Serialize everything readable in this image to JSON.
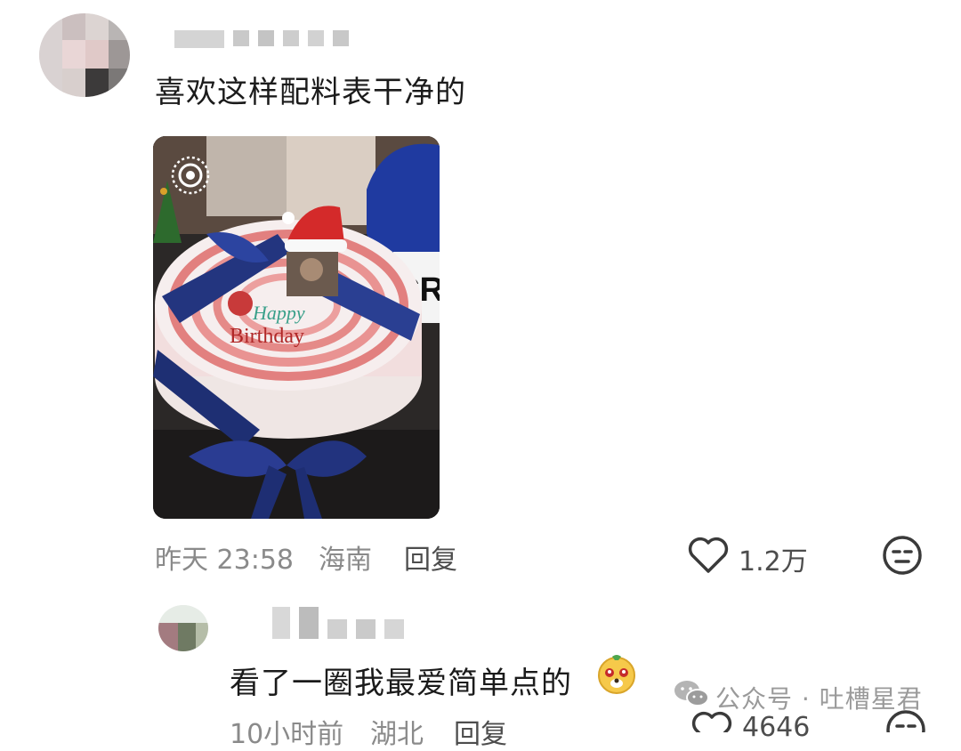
{
  "comment1": {
    "text": "喜欢这样配料表干净的",
    "time": "昨天 23:58",
    "location": "海南",
    "reply_label": "回复",
    "likes": "1.2万",
    "photo": {
      "topper_line1": "Happy",
      "topper_line2": "Birthday",
      "box_letters": "CR"
    }
  },
  "comment2": {
    "text": "看了一圈我最爱简单点的",
    "time": "10小时前",
    "location": "湖北",
    "reply_label": "回复",
    "likes": "4646"
  },
  "watermark": {
    "text": "公众号 · 吐槽星君"
  },
  "icons": {
    "like": "heart-outline-icon",
    "react": "neutral-face-icon",
    "emoji": "smiling-dog-emoji",
    "wechat": "wechat-logo-icon"
  },
  "colors": {
    "text": "#1b1b1b",
    "meta": "#8a8a8a",
    "icon": "#3a3a3a",
    "ribbon": "#23357f"
  }
}
